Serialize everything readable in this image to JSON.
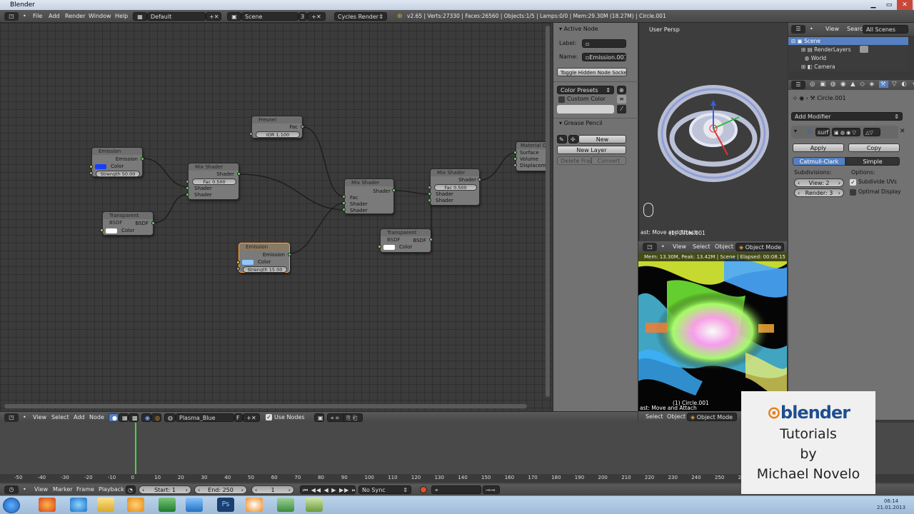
{
  "window": {
    "title": "Blender"
  },
  "infobar": {
    "menus": [
      "File",
      "Add",
      "Render",
      "Window",
      "Help"
    ],
    "layout": "Default",
    "scene": "Scene",
    "scene_num": "3",
    "engine": "Cycles Render",
    "stats": "v2.65 | Verts:27330 | Faces:26560 | Objects:1/5 | Lamps:0/0 | Mem:29.30M (18.27M) | Circle.001"
  },
  "nodes": {
    "emission1": {
      "title": "Emission",
      "out": "Emission",
      "color": "Color",
      "strength": "Strength 50.00",
      "color_hex": "#1a3cff"
    },
    "transparent1": {
      "title": "Transparent BSDF",
      "out": "BSDF",
      "color": "Color"
    },
    "mix1": {
      "title": "Mix Shader",
      "out": "Shader",
      "fac": "Fac 0.500",
      "in1": "Shader",
      "in2": "Shader"
    },
    "fresnel": {
      "title": "Fresnel",
      "out": "Fac",
      "ior": "IOR 1.100"
    },
    "mix2": {
      "title": "Mix Shader",
      "out": "Shader",
      "fac": "Fac",
      "in1": "Shader",
      "in2": "Shader"
    },
    "emission2": {
      "title": "Emission",
      "out": "Emission",
      "color": "Color",
      "strength": "Strength 15.00",
      "color_hex": "#8fc8ff"
    },
    "transparent2": {
      "title": "Transparent BSDF",
      "out": "BSDF",
      "color": "Color"
    },
    "mix3": {
      "title": "Mix Shader",
      "out": "Shader",
      "fac": "Fac 0.500",
      "in1": "Shader",
      "in2": "Shader"
    },
    "output": {
      "title": "Material Ou",
      "surface": "Surface",
      "volume": "Volume",
      "disp": "Displacemen"
    }
  },
  "npanel": {
    "active_node": "Active Node",
    "label_lbl": "Label:",
    "name_lbl": "Name:",
    "name_val": "Emission.001",
    "toggle": "Toggle Hidden Node Sockets",
    "color_presets": "Color Presets",
    "custom_color": "Custom Color",
    "grease": "Grease Pencil",
    "new": "New",
    "new_layer": "New Layer",
    "delete_frame": "Delete Frame",
    "convert": "Convert"
  },
  "viewport": {
    "persp": "User Persp",
    "status": "ast: Move and Attach",
    "obj": "(1) Circle.001"
  },
  "render_view": {
    "menus": [
      "View",
      "Select",
      "Object"
    ],
    "mode": "Object Mode",
    "info": "Mem: 13.30M, Peak: 13.42M | Scene | Elapsed: 00:08.15 | I",
    "obj": "(1) Circle.001",
    "status": "ast: Move and Attach",
    "bottom_menus": [
      "Select",
      "Object"
    ],
    "bottom_mode": "Object Mode"
  },
  "outliner": {
    "menus": [
      "View",
      "Search"
    ],
    "scenes": "All Scenes",
    "items": [
      "Scene",
      "RenderLayers",
      "World",
      "Camera"
    ]
  },
  "props": {
    "object": "Circle.001",
    "add_modifier": "Add Modifier",
    "mod_name": "surf",
    "apply": "Apply",
    "copy": "Copy",
    "catmull": "Catmull-Clark",
    "simple": "Simple",
    "subdivisions": "Subdivisions:",
    "options": "Options:",
    "view": "View: 2",
    "render": "Render: 3",
    "subdivide_uvs": "Subdivide UVs",
    "optimal": "Optimal Display"
  },
  "node_header": {
    "menus": [
      "View",
      "Select",
      "Add",
      "Node"
    ],
    "material": "Plasma_Blue",
    "f": "F",
    "use_nodes": "Use Nodes"
  },
  "timeline": {
    "ruler": [
      "-50",
      "-40",
      "-30",
      "-20",
      "-10",
      "0",
      "10",
      "20",
      "30",
      "40",
      "50",
      "60",
      "70",
      "80",
      "90",
      "100",
      "110",
      "120",
      "130",
      "140",
      "150",
      "160",
      "170",
      "180",
      "190",
      "200",
      "210",
      "220",
      "230",
      "240",
      "250",
      "260"
    ],
    "menus": [
      "View",
      "Marker",
      "Frame",
      "Playback"
    ],
    "start": "Start: 1",
    "end": "End: 250",
    "current": "1",
    "sync": "No Sync"
  },
  "watermark": {
    "brand": "blender",
    "line1": "Tutorials",
    "line2": "by",
    "line3": "Michael Novelo"
  },
  "taskbar": {
    "time": "06:14",
    "date": "21.01.2013"
  }
}
